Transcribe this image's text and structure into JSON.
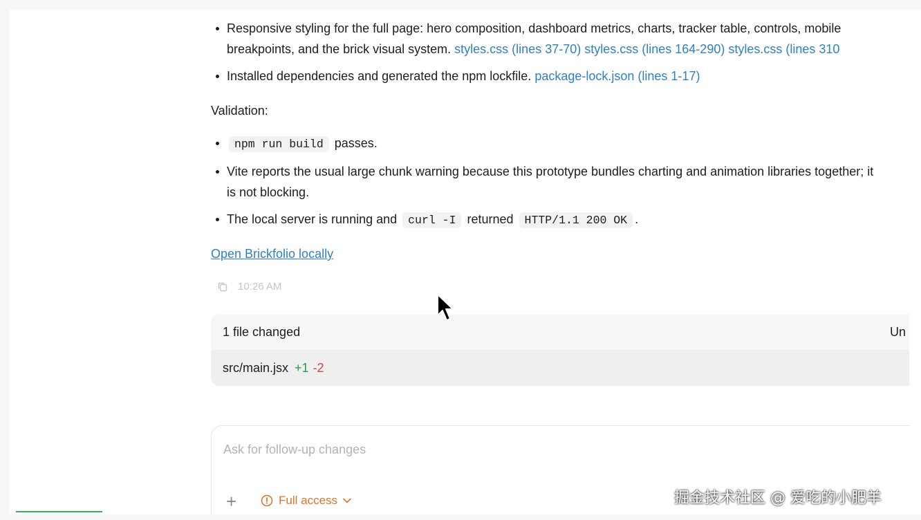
{
  "message": {
    "bullets_a": [
      {
        "text": "Responsive styling for the full page: hero composition, dashboard metrics, charts, tracker table, controls, mobile",
        "text2": "breakpoints, and the brick visual system.",
        "links": [
          "styles.css (lines 37-70)",
          "styles.css (lines 164-290)",
          "styles.css (lines 310"
        ]
      },
      {
        "text": "Installed dependencies and generated the npm lockfile.",
        "link": "package-lock.json (lines 1-17)"
      }
    ],
    "validation_label": "Validation:",
    "bullets_b": [
      {
        "code": "npm run build",
        "text": "passes."
      },
      {
        "text": "Vite reports the usual large chunk warning because this prototype bundles charting and animation libraries together; it",
        "text2": "is not blocking."
      },
      {
        "text": "The local server is running and",
        "code1": "curl -I",
        "mid": "returned",
        "code2": "HTTP/1.1 200 OK",
        "end": "."
      }
    ],
    "open_link": "Open Brickfolio locally",
    "timestamp": "10:26 AM"
  },
  "files_changed": {
    "title": "1 file changed",
    "right_label": "Un",
    "file": {
      "name": "src/main.jsx",
      "additions": "+1",
      "deletions": "-2"
    }
  },
  "composer": {
    "placeholder": "Ask for follow-up changes",
    "access_label": "Full access"
  },
  "watermark": "掘金技术社区 @ 爱吃的小肥羊",
  "colors": {
    "link": "#2f7fc4",
    "add": "#2e9a4a",
    "del": "#d04545",
    "access": "#d9742b"
  }
}
